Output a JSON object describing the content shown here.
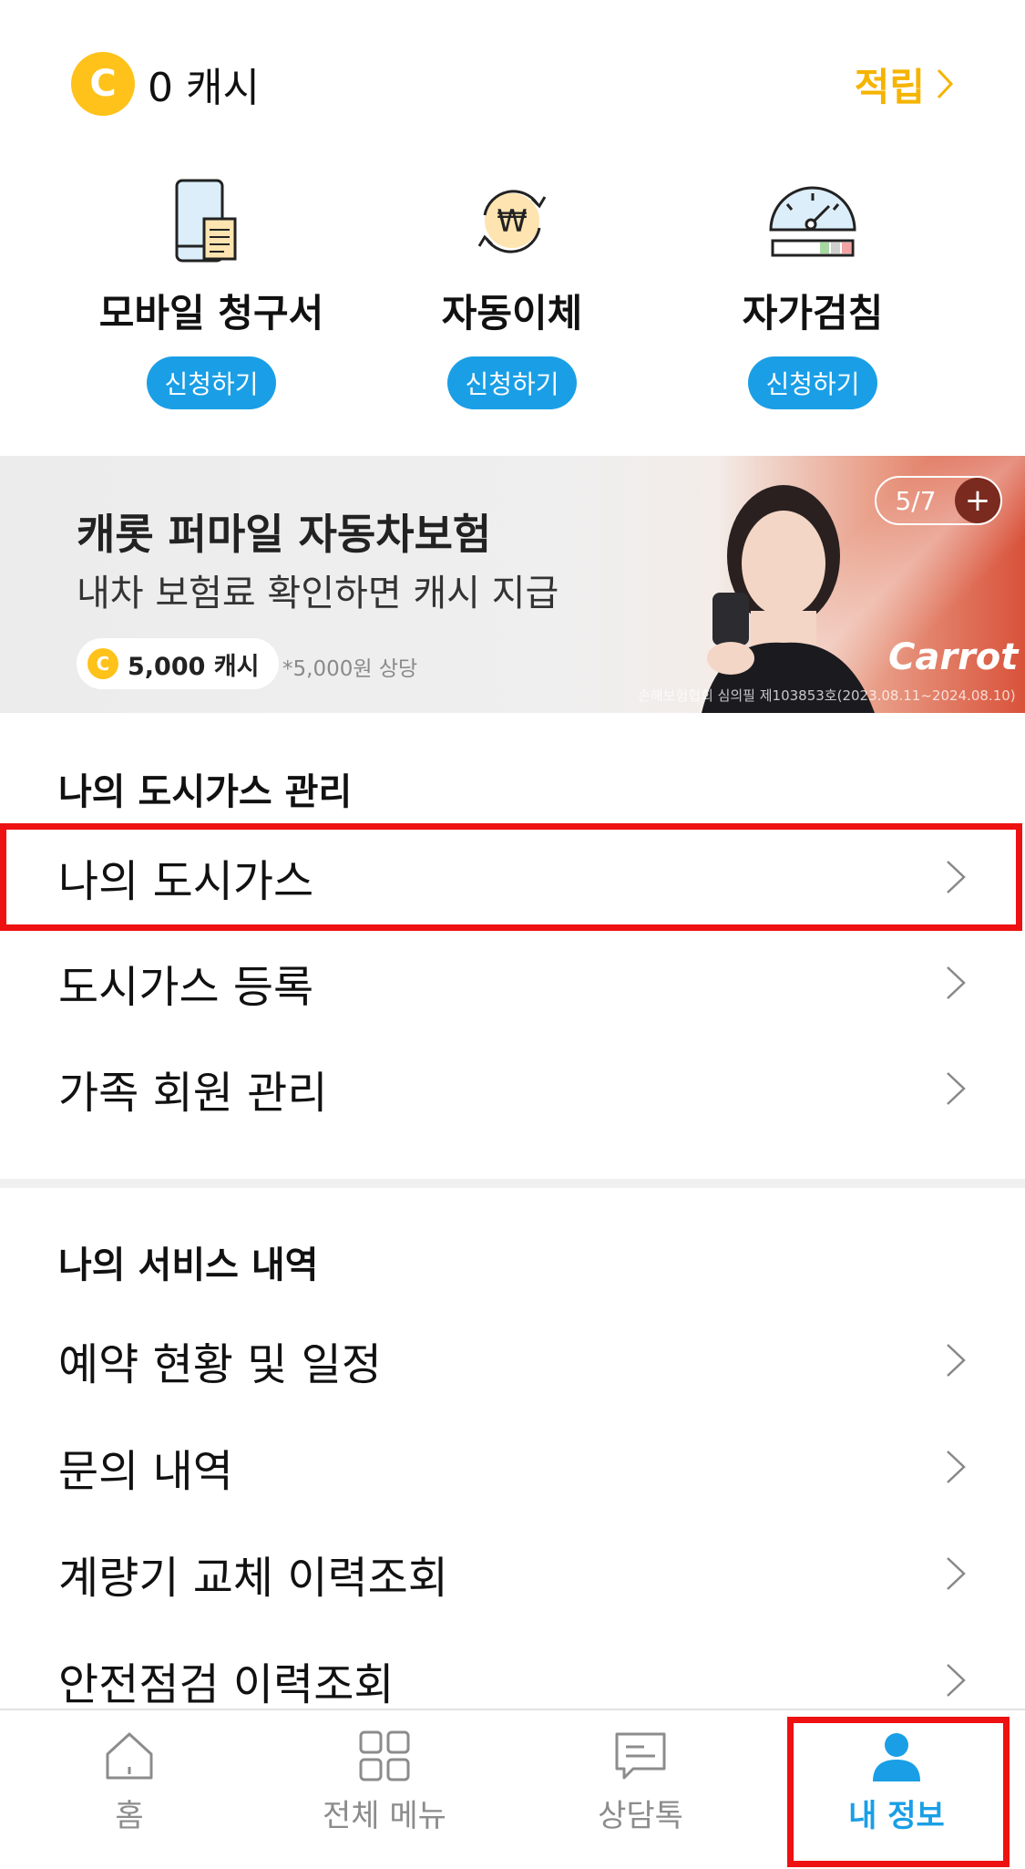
{
  "cash": {
    "amount_label": "0 캐시",
    "coin_letter": "C",
    "earn_label": "적립"
  },
  "services": [
    {
      "icon": "mobile-bill-icon",
      "title": "모바일 청구서",
      "button": "신청하기"
    },
    {
      "icon": "auto-transfer-icon",
      "title": "자동이체",
      "button": "신청하기"
    },
    {
      "icon": "self-meter-icon",
      "title": "자가검침",
      "button": "신청하기"
    }
  ],
  "banner": {
    "title": "캐롯 퍼마일 자동차보험",
    "subtitle": "내차 보험료 확인하면 캐시 지급",
    "reward": "5,000 캐시",
    "reward_coin": "C",
    "note": "*5,000원 상당",
    "pager": "5/7",
    "pager_plus": "+",
    "brand": "Carrot",
    "disclaimer": "손해보험협회 심의필 제103853호(2023.08.11~2024.08.10)"
  },
  "gas_management": {
    "title": "나의 도시가스 관리",
    "items": [
      "나의 도시가스",
      "도시가스 등록",
      "가족 회원 관리"
    ]
  },
  "service_history": {
    "title": "나의 서비스 내역",
    "items": [
      "예약 현황 및 일정",
      "문의 내역",
      "계량기 교체 이력조회",
      "안전점검 이력조회"
    ]
  },
  "tabs": [
    {
      "icon": "home-icon",
      "label": "홈"
    },
    {
      "icon": "grid-menu-icon",
      "label": "전체 메뉴"
    },
    {
      "icon": "chat-icon",
      "label": "상담톡"
    },
    {
      "icon": "person-icon",
      "label": "내 정보",
      "active": true
    }
  ],
  "colors": {
    "accent": "#1a9fe6",
    "coin": "#ffc21a",
    "earn": "#f5b400",
    "highlight": "#ee1111"
  }
}
